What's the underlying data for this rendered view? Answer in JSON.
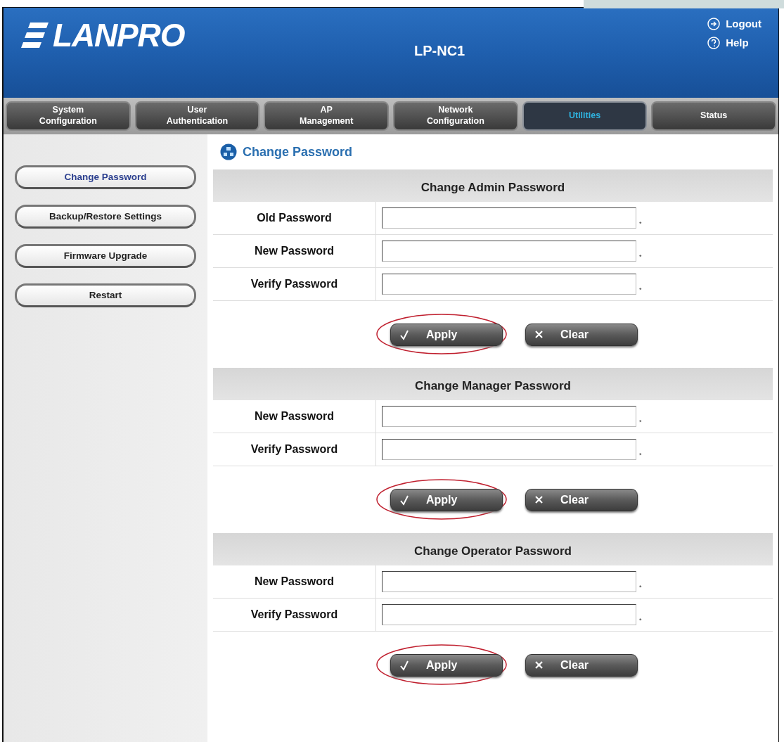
{
  "header": {
    "logo": "LANPRO",
    "model": "LP-NC1",
    "links": [
      {
        "kind": "logout",
        "label": "Logout"
      },
      {
        "kind": "help",
        "label": "Help"
      }
    ]
  },
  "tabs": [
    {
      "lines": [
        "System",
        "Configuration"
      ],
      "selected": false
    },
    {
      "lines": [
        "User",
        "Authentication"
      ],
      "selected": false
    },
    {
      "lines": [
        "AP",
        "Management"
      ],
      "selected": false
    },
    {
      "lines": [
        "Network",
        "Configuration"
      ],
      "selected": false
    },
    {
      "lines": [
        "Utilities"
      ],
      "selected": true
    },
    {
      "lines": [
        "Status"
      ],
      "selected": false
    }
  ],
  "sidebar": {
    "items": [
      {
        "label": "Change Password",
        "selected": true
      },
      {
        "label": "Backup/Restore Settings",
        "selected": false
      },
      {
        "label": "Firmware Upgrade",
        "selected": false
      },
      {
        "label": "Restart",
        "selected": false
      }
    ]
  },
  "page_title": "Change Password",
  "sections": [
    {
      "title": "Change Admin Password",
      "rows": [
        {
          "label": "Old Password",
          "mark": "*"
        },
        {
          "label": "New Password",
          "mark": "*"
        },
        {
          "label": "Verify Password",
          "mark": "*"
        }
      ],
      "buttons": [
        {
          "kind": "apply",
          "label": "Apply",
          "circled": true
        },
        {
          "kind": "clear",
          "label": "Clear",
          "circled": false
        }
      ]
    },
    {
      "title": "Change Manager Password",
      "rows": [
        {
          "label": "New Password",
          "mark": "*"
        },
        {
          "label": "Verify Password",
          "mark": "*"
        }
      ],
      "buttons": [
        {
          "kind": "apply",
          "label": "Apply",
          "circled": true
        },
        {
          "kind": "clear",
          "label": "Clear",
          "circled": false
        }
      ]
    },
    {
      "title": "Change Operator Password",
      "rows": [
        {
          "label": "New Password",
          "mark": "*"
        },
        {
          "label": "Verify Password",
          "mark": "*"
        }
      ],
      "buttons": [
        {
          "kind": "apply",
          "label": "Apply",
          "circled": true
        },
        {
          "kind": "clear",
          "label": "Clear",
          "circled": false
        }
      ]
    }
  ]
}
